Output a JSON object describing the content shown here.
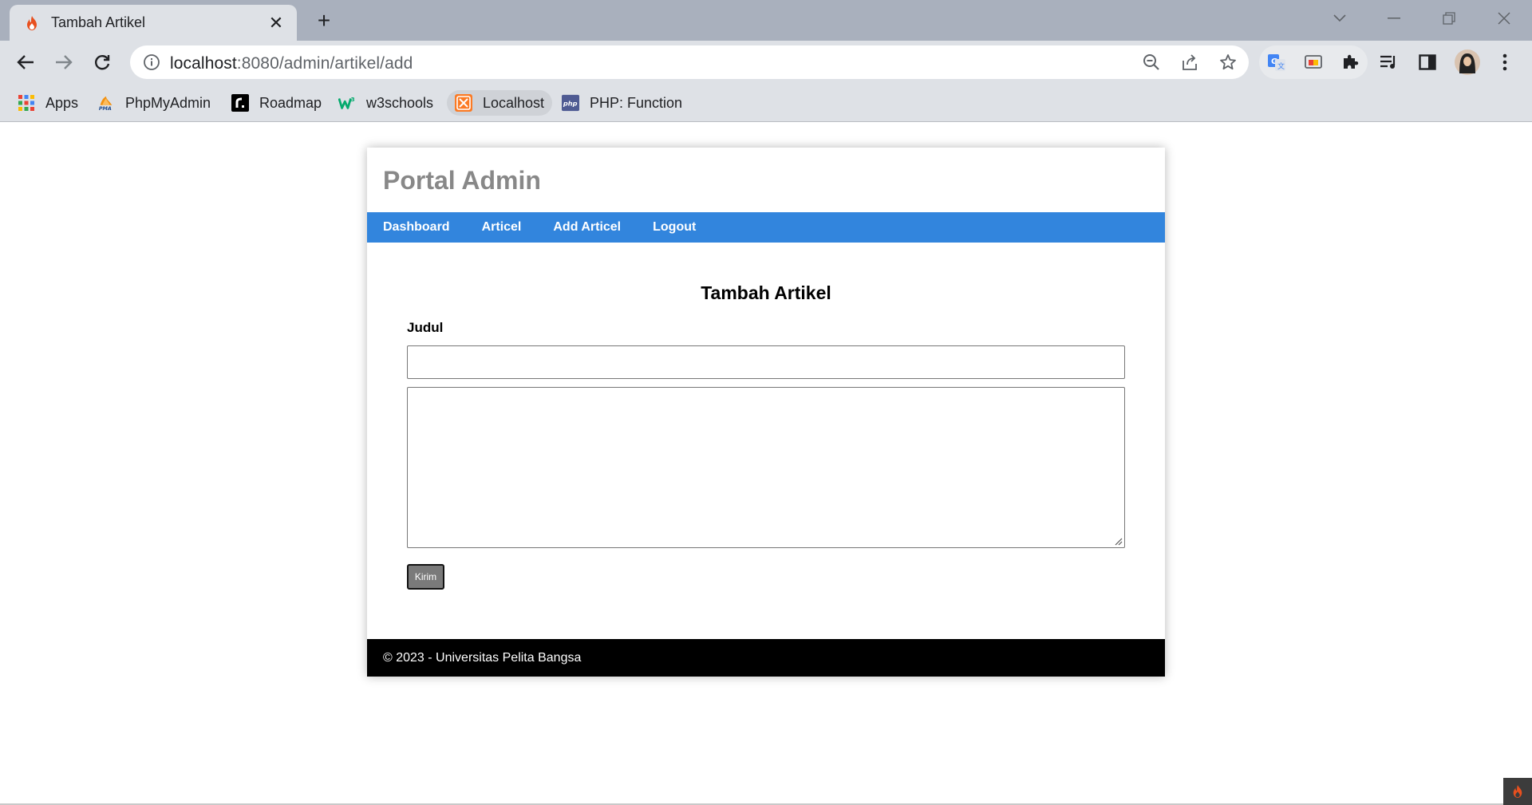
{
  "browser": {
    "tab_title": "Tambah Artikel",
    "tab_close": "✕",
    "new_tab": "+",
    "url_host": "localhost",
    "url_rest": ":8080/admin/artikel/add",
    "window_controls": {
      "minimize": "—",
      "restore": "❐",
      "close": "✕",
      "tab_search": "⌄"
    }
  },
  "bookmarks": [
    {
      "label": "Apps",
      "icon": "apps-grid-icon"
    },
    {
      "label": "PhpMyAdmin",
      "icon": "phpmyadmin-icon"
    },
    {
      "label": "Roadmap",
      "icon": "roadmap-icon"
    },
    {
      "label": "w3schools",
      "icon": "w3schools-icon"
    },
    {
      "label": "Localhost",
      "icon": "xampp-icon"
    },
    {
      "label": "PHP: Function",
      "icon": "php-icon"
    }
  ],
  "site": {
    "title": "Portal Admin",
    "nav": [
      "Dashboard",
      "Articel",
      "Add Articel",
      "Logout"
    ],
    "form": {
      "heading": "Tambah Artikel",
      "judul_label": "Judul",
      "judul_value": "",
      "isi_value": "",
      "submit_label": "Kirim"
    },
    "footer": "© 2023 - Universitas Pelita Bangsa"
  },
  "colors": {
    "nav_bg": "#3285dd",
    "footer_bg": "#000000",
    "title_color": "#888888",
    "submit_bg": "#7a7a7a"
  }
}
